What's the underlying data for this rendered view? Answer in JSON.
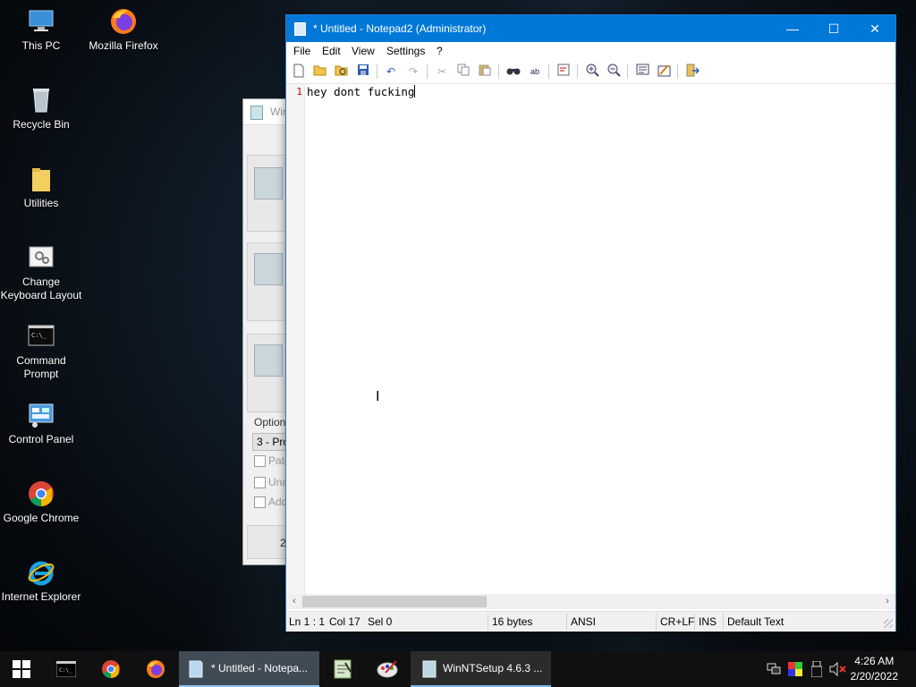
{
  "desktop": {
    "icons": [
      {
        "label": "This PC"
      },
      {
        "label": "Mozilla Firefox"
      },
      {
        "label": "Recycle Bin"
      },
      {
        "label": "Utilities"
      },
      {
        "label": "Change Keyboard Layout"
      },
      {
        "label": "Command Prompt"
      },
      {
        "label": "Control Panel"
      },
      {
        "label": "Google Chrome"
      },
      {
        "label": "Internet Explorer"
      }
    ]
  },
  "background_window": {
    "title_partial": "Win",
    "options_label": "Option",
    "select_value": "3 - Pro",
    "checkbox_labels": [
      "Patc",
      "Una",
      "Add"
    ],
    "bottom_text": "2"
  },
  "notepad": {
    "title": "* Untitled - Notepad2 (Administrator)",
    "menu": [
      "File",
      "Edit",
      "View",
      "Settings",
      "?"
    ],
    "line_number": "1",
    "content": "hey dont fucking",
    "status": {
      "position": "Ln 1 : 1",
      "column": "Col 17",
      "selection": "Sel 0",
      "size": "16 bytes",
      "encoding": "ANSI",
      "line_endings": "CR+LF",
      "mode": "INS",
      "scheme": "Default Text"
    },
    "window_buttons": {
      "minimize": "—",
      "maximize": "☐",
      "close": "✕"
    }
  },
  "taskbar": {
    "tasks": [
      {
        "label": "* Untitled - Notepa..."
      },
      {
        "label": "WinNTSetup 4.6.3 ..."
      }
    ],
    "clock": {
      "time": "4:26 AM",
      "date": "2/20/2022"
    }
  },
  "colors": {
    "titlebar": "#0078d7",
    "taskbar": "#101010",
    "line_number": "#cc0000"
  }
}
